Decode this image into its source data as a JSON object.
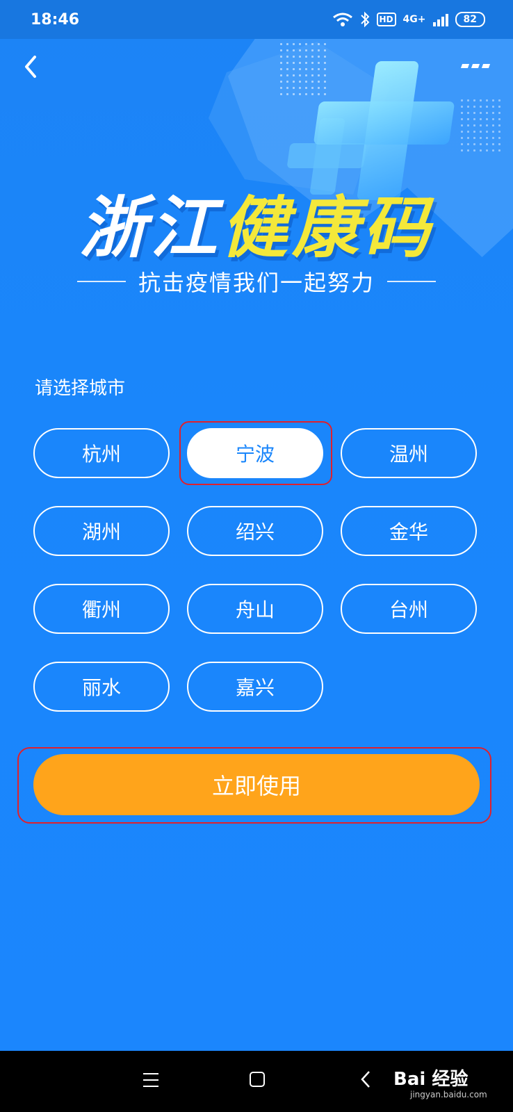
{
  "status_bar": {
    "time": "18:46",
    "network": "4G+",
    "hd_label": "HD",
    "battery": "82"
  },
  "header": {
    "title_part1": "浙江",
    "title_part2": "健康码",
    "subtitle": "抗击疫情我们一起努力"
  },
  "city_select": {
    "prompt": "请选择城市",
    "cities": [
      "杭州",
      "宁波",
      "温州",
      "湖州",
      "绍兴",
      "金华",
      "衢州",
      "舟山",
      "台州",
      "丽水",
      "嘉兴"
    ],
    "selected": "宁波"
  },
  "action": {
    "use_label": "立即使用"
  },
  "watermark": {
    "text": "Bai 经验",
    "sub": "jingyan.baidu.com"
  },
  "colors": {
    "background": "#1a86fb",
    "accent_button": "#ffa41b",
    "title_highlight": "#f4e83a",
    "annotation": "#e0202c"
  }
}
